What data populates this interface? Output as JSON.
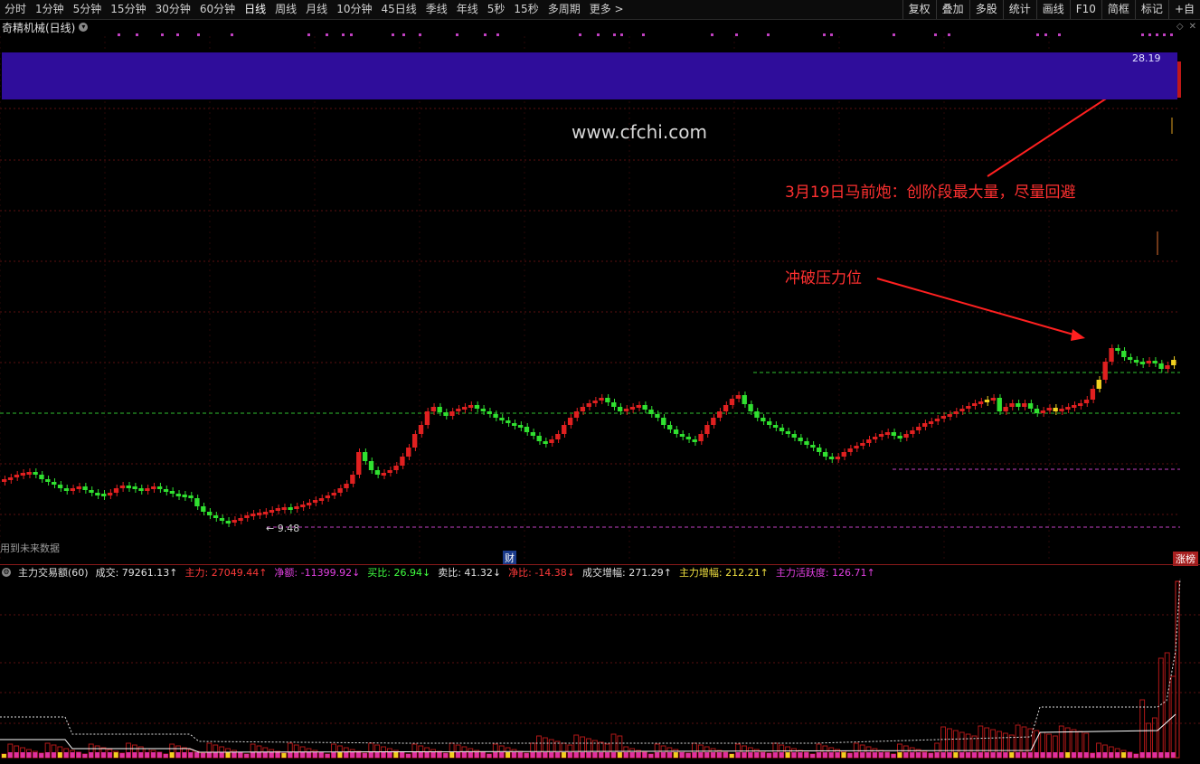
{
  "toolbar": {
    "periods": [
      "分时",
      "1分钟",
      "5分钟",
      "15分钟",
      "30分钟",
      "60分钟",
      "日线",
      "周线",
      "月线",
      "10分钟",
      "45日线",
      "季线",
      "年线",
      "5秒",
      "15秒",
      "多周期",
      "更多 >"
    ],
    "active": "日线",
    "right_buttons": [
      "复权",
      "叠加",
      "多股",
      "统计",
      "画线",
      "F10",
      "简框",
      "标记",
      "+自"
    ]
  },
  "stock": {
    "name": "奇精机械(日线)"
  },
  "chart": {
    "top_label": "28.19",
    "low_label": "← 9.48",
    "watermark": "www.cfchi.com",
    "annotation_1": "3月19日马前炮：创阶段最大量，尽量回避",
    "annotation_2": "冲破压力位",
    "future_text": "用到未来数据",
    "cai_badge": "财",
    "zhangbang": "涨榜",
    "colors": {
      "up": "#e02020",
      "down": "#30e030",
      "highlight": "#f0d020",
      "band": "#2f0d9b",
      "grid": "#5a1010"
    }
  },
  "indicator": {
    "name": "主力交易额(60)",
    "fields": [
      {
        "label": "成交:",
        "value": "79261.13",
        "arrow": "↑",
        "color": "#e0e0e0"
      },
      {
        "label": "主力:",
        "value": "27049.44",
        "arrow": "↑",
        "color": "#ff3a3a"
      },
      {
        "label": "净额:",
        "value": "-11399.92",
        "arrow": "↓",
        "color": "#e040e0"
      },
      {
        "label": "买比:",
        "value": "26.94",
        "arrow": "↓",
        "color": "#40ff40"
      },
      {
        "label": "卖比:",
        "value": "41.32",
        "arrow": "↓",
        "color": "#e0e0e0"
      },
      {
        "label": "净比:",
        "value": "-14.38",
        "arrow": "↓",
        "color": "#ff3a3a"
      },
      {
        "label": "成交增幅:",
        "value": "271.29",
        "arrow": "↑",
        "color": "#e0e0e0"
      },
      {
        "label": "主力增幅:",
        "value": "212.21",
        "arrow": "↑",
        "color": "#f0e040"
      },
      {
        "label": "主力活跃度:",
        "value": "126.71",
        "arrow": "↑",
        "color": "#e040e0"
      }
    ]
  }
}
